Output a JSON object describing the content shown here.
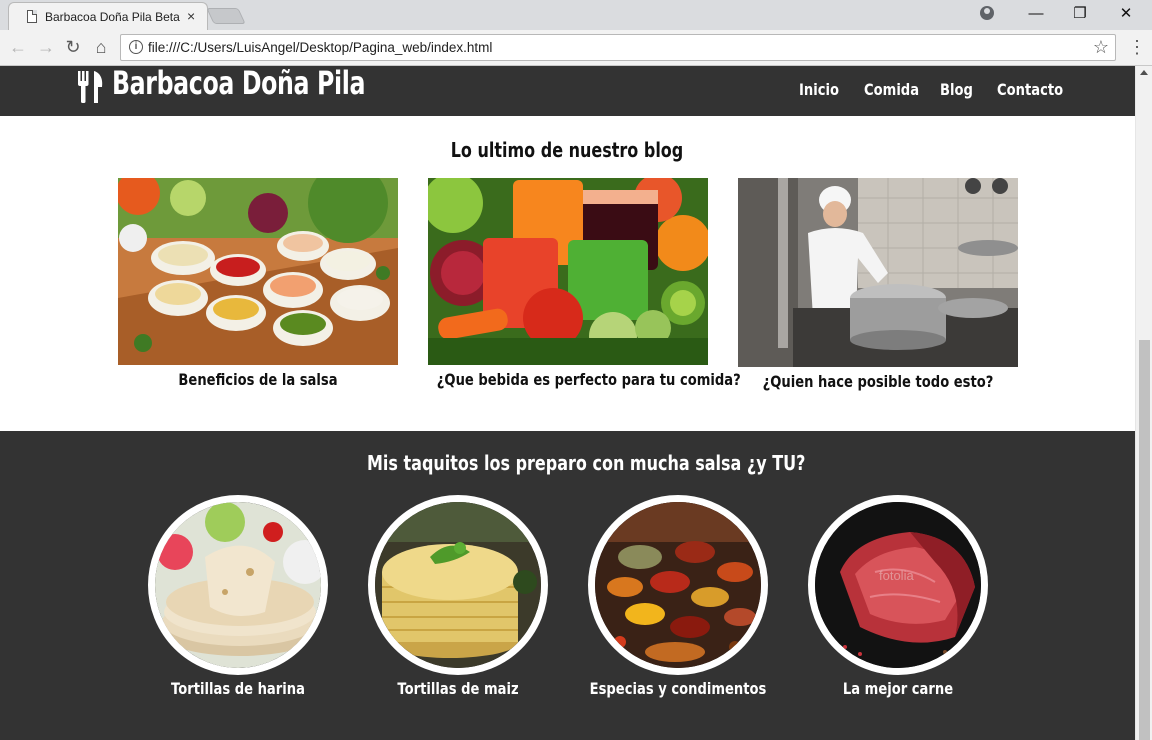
{
  "browser": {
    "tab_title": "Barbacoa Doña Pila Beta",
    "tab_close": "×",
    "url": "file:///C:/Users/LuisAngel/Desktop/Pagina_web/index.html",
    "window_controls": {
      "minimize": "—",
      "restore": "❐",
      "close": "✕"
    },
    "nav": {
      "back": "←",
      "forward": "→",
      "reload": "↻",
      "home": "⌂"
    },
    "info": "i",
    "star": "☆",
    "menu": "⋮"
  },
  "site": {
    "brand": "Barbacoa Doña Pila",
    "nav": [
      "Inicio",
      "Comida",
      "Blog",
      "Contacto"
    ],
    "blog": {
      "title": "Lo ultimo de nuestro blog",
      "posts": [
        {
          "caption": "Beneficios de la salsa"
        },
        {
          "caption": "¿Que bebida es perfecto para tu comida?"
        },
        {
          "caption": "¿Quien hace posible todo esto?"
        }
      ]
    },
    "products": {
      "title": "Mis taquitos los preparo con mucha salsa ¿y TU?",
      "items": [
        {
          "label": "Tortillas de harina"
        },
        {
          "label": "Tortillas de maiz"
        },
        {
          "label": "Especias y condimentos"
        },
        {
          "label": "La mejor carne",
          "watermark": "fotolia"
        }
      ]
    }
  },
  "colors": {
    "header_bg": "#333333",
    "footer_bg": "#333333",
    "text_light": "#ffffff",
    "text_dark": "#111111"
  }
}
